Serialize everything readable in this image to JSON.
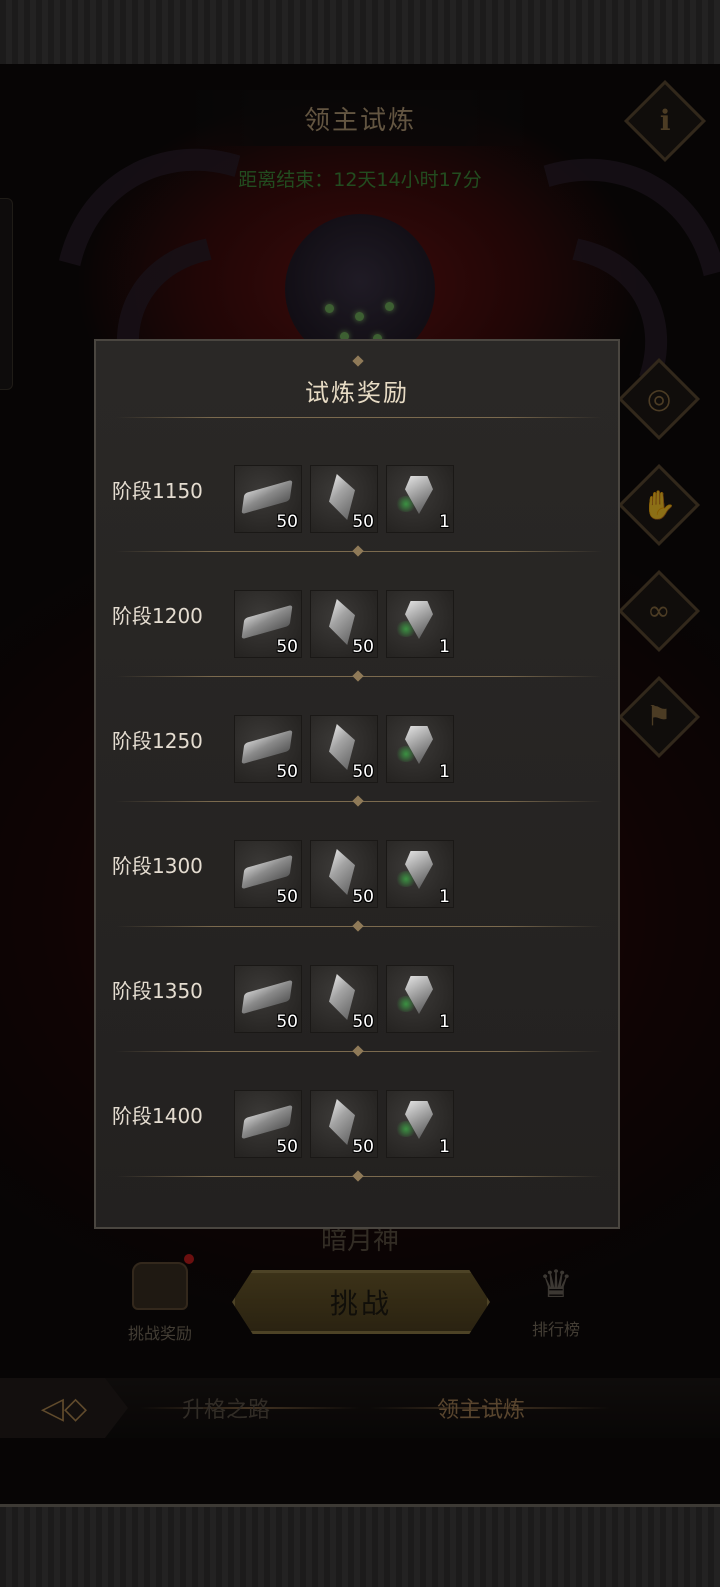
{
  "header": {
    "title": "领主试炼",
    "countdown": "距离结束：12天14小时17分"
  },
  "side_buttons": [
    {
      "name": "info",
      "icon": "i"
    },
    {
      "name": "vortex",
      "icon": "spiral-icon"
    },
    {
      "name": "hand",
      "icon": "hand-icon"
    },
    {
      "name": "chain",
      "icon": "chain-icon"
    },
    {
      "name": "flag",
      "icon": "flag-icon"
    }
  ],
  "popup": {
    "title": "试炼奖励",
    "rows": [
      {
        "stage": "阶段1150",
        "items": [
          {
            "icon": "iron-ingot-icon",
            "qty": "50"
          },
          {
            "icon": "crystal-shard-icon",
            "qty": "50"
          },
          {
            "icon": "gem-icon",
            "qty": "1"
          }
        ]
      },
      {
        "stage": "阶段1200",
        "items": [
          {
            "icon": "iron-ingot-icon",
            "qty": "50"
          },
          {
            "icon": "crystal-shard-icon",
            "qty": "50"
          },
          {
            "icon": "gem-icon",
            "qty": "1"
          }
        ]
      },
      {
        "stage": "阶段1250",
        "items": [
          {
            "icon": "iron-ingot-icon",
            "qty": "50"
          },
          {
            "icon": "crystal-shard-icon",
            "qty": "50"
          },
          {
            "icon": "gem-icon",
            "qty": "1"
          }
        ]
      },
      {
        "stage": "阶段1300",
        "items": [
          {
            "icon": "iron-ingot-icon",
            "qty": "50"
          },
          {
            "icon": "crystal-shard-icon",
            "qty": "50"
          },
          {
            "icon": "gem-icon",
            "qty": "1"
          }
        ]
      },
      {
        "stage": "阶段1350",
        "items": [
          {
            "icon": "iron-ingot-icon",
            "qty": "50"
          },
          {
            "icon": "crystal-shard-icon",
            "qty": "50"
          },
          {
            "icon": "gem-icon",
            "qty": "1"
          }
        ]
      },
      {
        "stage": "阶段1400",
        "items": [
          {
            "icon": "iron-ingot-icon",
            "qty": "50"
          },
          {
            "icon": "crystal-shard-icon",
            "qty": "50"
          },
          {
            "icon": "gem-icon",
            "qty": "1"
          }
        ]
      }
    ]
  },
  "bottom": {
    "boss_name": "暗月神",
    "reward_label": "挑战奖励",
    "challenge_label": "挑战",
    "rank_label": "排行榜",
    "nav": {
      "tab1": "升格之路",
      "tab2": "领主试炼"
    }
  },
  "colors": {
    "countdown": "#3e8a3a",
    "accent_gold": "#8d7a45",
    "popup_bg": "#2a2826"
  }
}
